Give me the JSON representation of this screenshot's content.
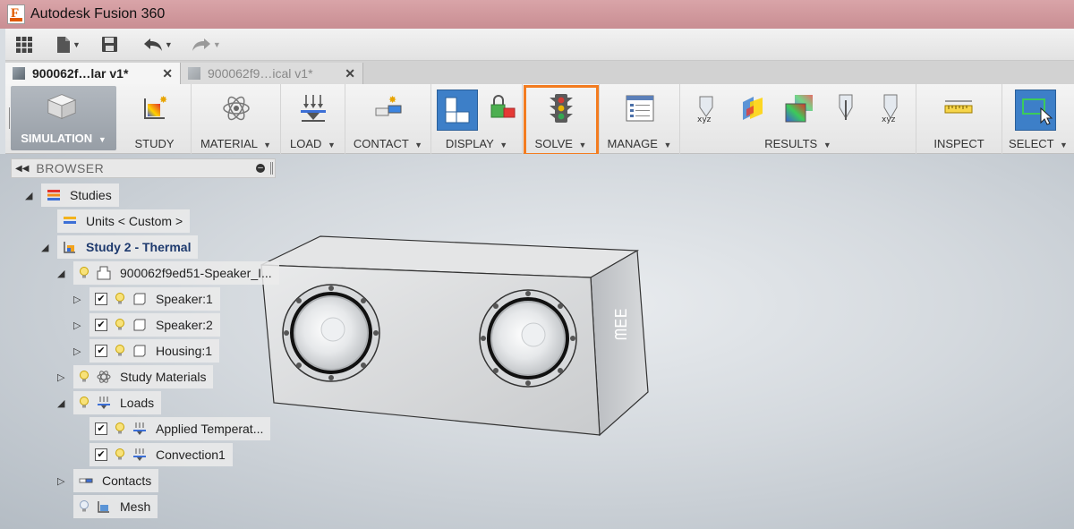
{
  "window": {
    "title": "Autodesk Fusion 360"
  },
  "tabs": [
    {
      "label": "900062f…lar v1*",
      "active": true
    },
    {
      "label": "900062f9…ical v1*",
      "active": false
    }
  ],
  "ribbon": {
    "workspace": "SIMULATION",
    "groups": {
      "study": "STUDY",
      "material": "MATERIAL",
      "load": "LOAD",
      "contact": "CONTACT",
      "display": "DISPLAY",
      "solve": "SOLVE",
      "manage": "MANAGE",
      "results": "RESULTS",
      "inspect": "INSPECT",
      "select": "SELECT"
    },
    "highlight_color": "#f37c20"
  },
  "browser": {
    "title": "BROWSER",
    "nodes": {
      "studies": "Studies",
      "units": "Units < Custom >",
      "study2": "Study 2 - Thermal",
      "component": "900062f9ed51-Speaker_I...",
      "speaker1": "Speaker:1",
      "speaker2": "Speaker:2",
      "housing1": "Housing:1",
      "materials": "Study Materials",
      "loads": "Loads",
      "applied_temp": "Applied Temperat...",
      "convection": "Convection1",
      "contacts": "Contacts",
      "mesh": "Mesh"
    }
  },
  "model": {
    "logo_text": "ᗰEE"
  }
}
